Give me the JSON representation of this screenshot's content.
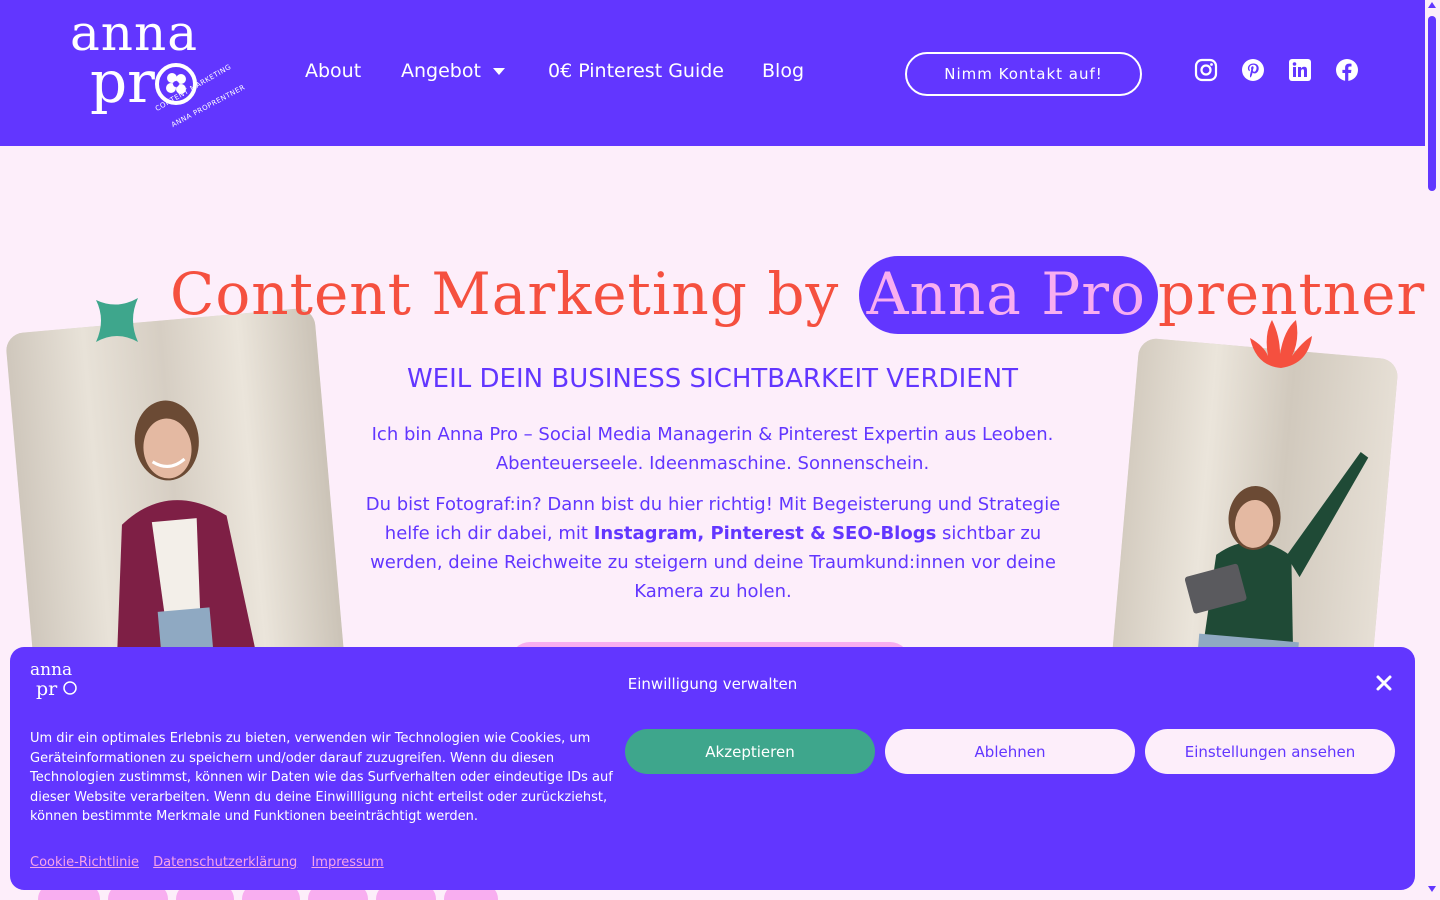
{
  "logo": {
    "line1": "anna",
    "line2": "pr",
    "tagline1": "CONTENT MARKETING",
    "tagline2": "ANNA PROPRENTNER"
  },
  "nav": {
    "about": "About",
    "angebot": "Angebot",
    "guide": "0€ Pinterest Guide",
    "blog": "Blog"
  },
  "header": {
    "contact_label": "Nimm Kontakt auf!"
  },
  "social": [
    "instagram-icon",
    "pinterest-icon",
    "linkedin-icon",
    "facebook-icon"
  ],
  "hero": {
    "title_before": "Content Marketing by ",
    "title_highlight": "Anna Pro",
    "title_after": "prentner",
    "subtitle": "WEIL DEIN BUSINESS SICHTBARKEIT VERDIENT",
    "intro_line1": "Ich bin Anna Pro – Social Media Managerin & Pinterest Expertin aus Leoben.",
    "intro_line2": "Abenteuerseele. Ideenmaschine. Sonnenschein.",
    "body_part1": "Du bist Fotograf:in? Dann bist du hier richtig! Mit Begeisterung und Strategie helfe ich dir dabei, mit ",
    "body_bold": "Instagram, Pinterest & SEO-Blogs",
    "body_part2": " sichtbar zu werden, deine Reichweite zu steigern und deine Traumkund:innen vor deine Kamera zu holen."
  },
  "cookie": {
    "title": "Einwilligung verwalten",
    "text": "Um dir ein optimales Erlebnis zu bieten, verwenden wir Technologien wie Cookies, um Geräteinformationen zu speichern und/oder darauf zuzugreifen. Wenn du diesen Technologien zustimmst, können wir Daten wie das Surfverhalten oder eindeutige IDs auf dieser Website verarbeiten. Wenn du deine Einwillligung nicht erteilst oder zurückziehst, können bestimmte Merkmale und Funktionen beeinträchtigt werden.",
    "accept": "Akzeptieren",
    "reject": "Ablehnen",
    "settings": "Einstellungen ansehen",
    "links": [
      "Cookie-Richtlinie",
      "Datenschutzerklärung",
      "Impressum"
    ]
  },
  "colors": {
    "brand_purple": "#6236ff",
    "coral": "#f5503f",
    "pink": "#f8aef0",
    "teal": "#3ea68c",
    "background": "#fdeefa"
  }
}
